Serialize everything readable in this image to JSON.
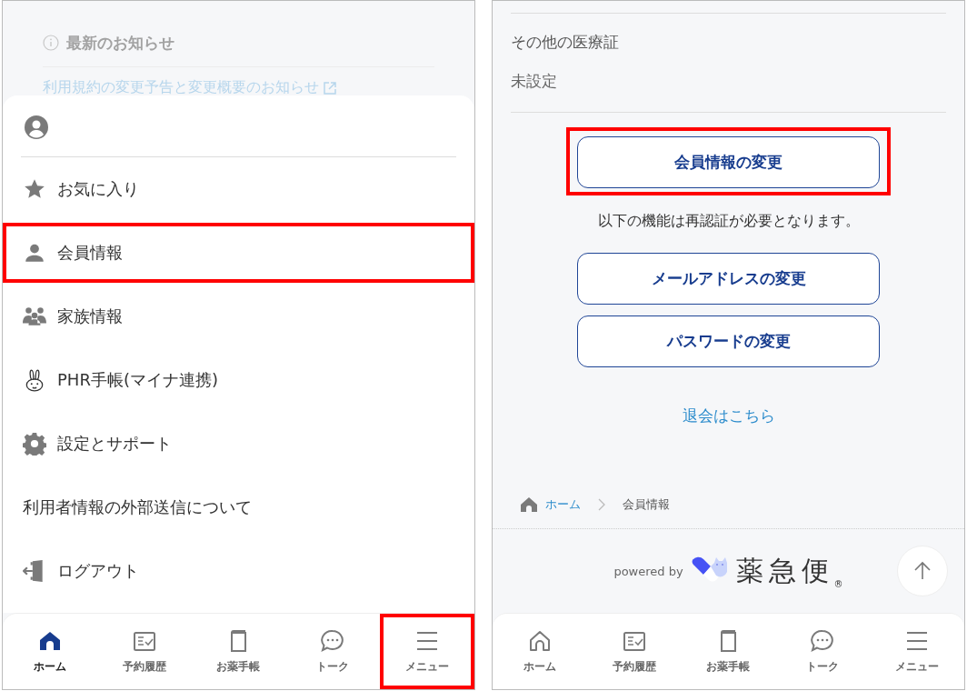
{
  "left_screen": {
    "notice": {
      "title": "最新のお知らせ",
      "link": "利用規約の変更予告と変更概要のお知らせ"
    },
    "menu": [
      {
        "kind": "star",
        "label": "お気に入り",
        "highlighted": false
      },
      {
        "kind": "person",
        "label": "会員情報",
        "highlighted": true
      },
      {
        "kind": "family",
        "label": "家族情報",
        "highlighted": false
      },
      {
        "kind": "rabbit",
        "label": "PHR手帳(マイナ連携)",
        "highlighted": false
      },
      {
        "kind": "gear",
        "label": "設定とサポート",
        "highlighted": false
      },
      {
        "kind": "plain",
        "label": "利用者情報の外部送信について",
        "highlighted": false
      },
      {
        "kind": "logout",
        "label": "ログアウト",
        "highlighted": false
      }
    ],
    "nav": [
      {
        "kind": "home",
        "label": "ホーム",
        "selected": true,
        "highlighted": false
      },
      {
        "kind": "history",
        "label": "予約履歴",
        "selected": false,
        "highlighted": false
      },
      {
        "kind": "notebook",
        "label": "お薬手帳",
        "selected": false,
        "highlighted": false
      },
      {
        "kind": "talk",
        "label": "トーク",
        "selected": false,
        "highlighted": false
      },
      {
        "kind": "menu",
        "label": "メニュー",
        "selected": false,
        "highlighted": true
      }
    ]
  },
  "right_screen": {
    "fields": [
      {
        "label": "その他の医療証",
        "value": "未設定"
      }
    ],
    "primary_button": {
      "label": "会員情報の変更",
      "highlighted": true
    },
    "note": "以下の機能は再認証が必要となります。",
    "buttons": [
      {
        "label": "メールアドレスの変更",
        "highlighted": false
      },
      {
        "label": "パスワードの変更",
        "highlighted": false
      }
    ],
    "withdraw_link": "退会はこちら",
    "breadcrumb": [
      "ホーム",
      "会員情報"
    ],
    "footer": {
      "powered_by": "powered by",
      "logo": "薬急便",
      "registered": "®"
    },
    "nav": [
      {
        "kind": "home",
        "label": "ホーム",
        "selected": false,
        "highlighted": false
      },
      {
        "kind": "history",
        "label": "予約履歴",
        "selected": false,
        "highlighted": false
      },
      {
        "kind": "notebook",
        "label": "お薬手帳",
        "selected": false,
        "highlighted": false
      },
      {
        "kind": "talk",
        "label": "トーク",
        "selected": false,
        "highlighted": false
      },
      {
        "kind": "menu",
        "label": "メニュー",
        "selected": false,
        "highlighted": false
      }
    ]
  }
}
